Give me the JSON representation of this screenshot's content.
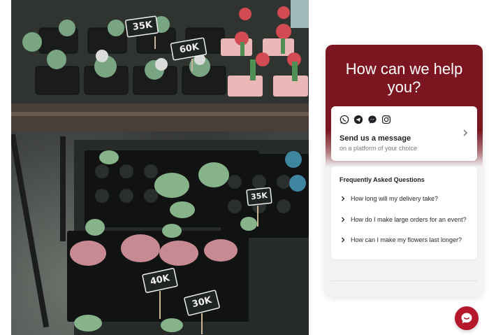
{
  "widget": {
    "title": "How can we help you?",
    "accent_color": "#7b1520",
    "message_card": {
      "icons": [
        "whatsapp-icon",
        "telegram-icon",
        "messenger-icon",
        "instagram-icon"
      ],
      "title": "Send us a message",
      "subtitle": "on a platform of your choice"
    },
    "faq": {
      "heading": "Frequently Asked Questions",
      "items": [
        "How long will my delivery take?",
        "How do I make large orders for an event?",
        "How can I make my flowers last longer?"
      ]
    }
  },
  "photo": {
    "price_tags": [
      "35K",
      "60K",
      "35K",
      "40K",
      "30K"
    ]
  },
  "launcher": {
    "color": "#b5182a",
    "icon": "chat-smile-icon"
  }
}
